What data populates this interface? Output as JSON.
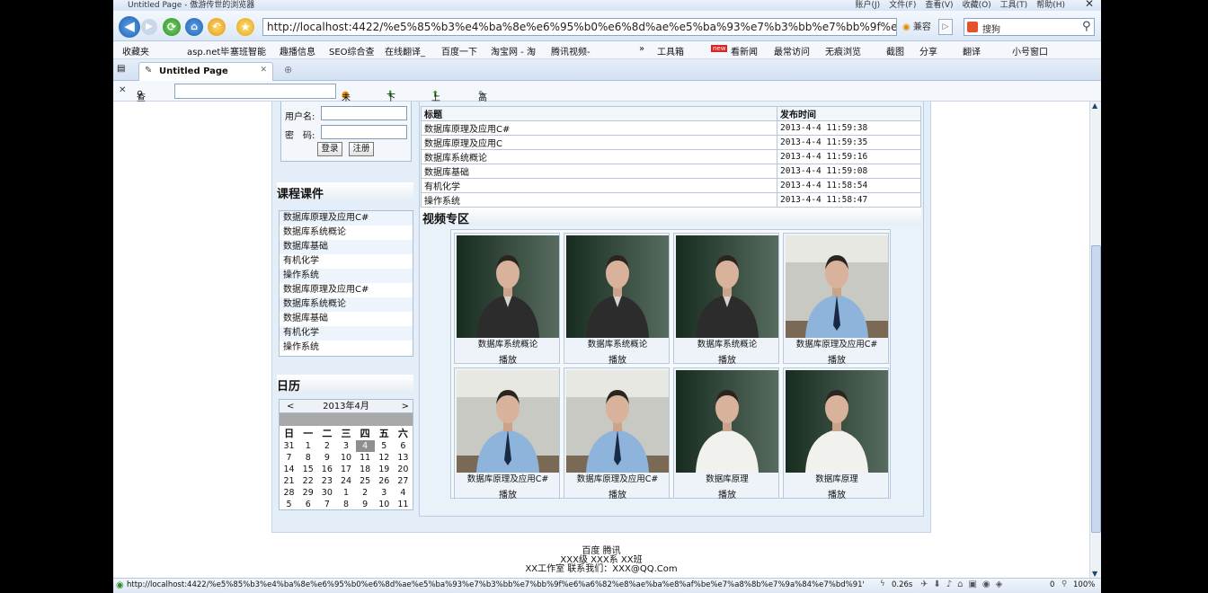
{
  "window": {
    "title": "Untitled Page - 傲游传世的浏览器",
    "menu": [
      "账户(J)",
      "文件(F)",
      "查看(V)",
      "收藏(O)",
      "工具(T)",
      "帮助(H)"
    ]
  },
  "nav": {
    "url": "http://localhost:4422/%e5%85%b3%e4%ba%8e%e6%95%b0%e6%8d%ae%e5%ba%93%e7%b3%bb%e7%bb%9f%e6%a6%",
    "compat": "兼容",
    "search_placeholder": "搜狗"
  },
  "favorites": {
    "left": [
      "收藏夹",
      "asp.net毕",
      "塞班智能",
      "趣播信息",
      "SEO综合查",
      "在线翻译_",
      "百度一下",
      "淘宝网 - 淘",
      "腾讯视频-"
    ],
    "right": [
      "工具箱",
      "看新闻",
      "最常访问",
      "无痕浏览",
      "截图",
      "分享",
      "翻译",
      "小号窗口"
    ]
  },
  "tab": {
    "title": "Untitled Page"
  },
  "find": {
    "label": "查找:",
    "value": "",
    "not_found": "未查找",
    "next": "下一个",
    "prev": "上一个",
    "highlight": "高亮"
  },
  "login": {
    "username_label": "用户名:",
    "password_label": "密　码:",
    "login_btn": "登录",
    "register_btn": "注册"
  },
  "courses": {
    "heading": "课程课件",
    "items": [
      "数据库原理及应用C#",
      "数据库系统概论",
      "数据库基础",
      "有机化学",
      "操作系统",
      "数据库原理及应用C#",
      "数据库系统概论",
      "数据库基础",
      "有机化学",
      "操作系统"
    ]
  },
  "calendar": {
    "heading": "日历",
    "month": "2013年4月",
    "prev": "<",
    "next": ">",
    "weekdays": [
      "日",
      "一",
      "二",
      "三",
      "四",
      "五",
      "六"
    ],
    "weeks": [
      [
        "31",
        "1",
        "2",
        "3",
        "4",
        "5",
        "6"
      ],
      [
        "7",
        "8",
        "9",
        "10",
        "11",
        "12",
        "13"
      ],
      [
        "14",
        "15",
        "16",
        "17",
        "18",
        "19",
        "20"
      ],
      [
        "21",
        "22",
        "23",
        "24",
        "25",
        "26",
        "27"
      ],
      [
        "28",
        "29",
        "30",
        "1",
        "2",
        "3",
        "4"
      ],
      [
        "5",
        "6",
        "7",
        "8",
        "9",
        "10",
        "11"
      ]
    ],
    "selected": "4"
  },
  "news": {
    "col_title": "标题",
    "col_time": "发布时间",
    "rows": [
      {
        "title": "数据库原理及应用C#",
        "time": "2013-4-4 11:59:38"
      },
      {
        "title": "数据库原理及应用C",
        "time": "2013-4-4 11:59:35"
      },
      {
        "title": "数据库系统概论",
        "time": "2013-4-4 11:59:16"
      },
      {
        "title": "数据库基础",
        "time": "2013-4-4 11:59:08"
      },
      {
        "title": "有机化学",
        "time": "2013-4-4 11:58:54"
      },
      {
        "title": "操作系统",
        "time": "2013-4-4 11:58:47"
      }
    ]
  },
  "videos": {
    "heading": "视频专区",
    "play_label": "播放",
    "items": [
      {
        "title": "数据库系统概论",
        "shirt": "dark",
        "board": "green"
      },
      {
        "title": "数据库系统概论",
        "shirt": "dark",
        "board": "green"
      },
      {
        "title": "数据库系统概论",
        "shirt": "dark",
        "board": "green"
      },
      {
        "title": "数据库原理及应用C#",
        "shirt": "blue",
        "board": "room"
      },
      {
        "title": "数据库原理及应用C#",
        "shirt": "blue",
        "board": "room"
      },
      {
        "title": "数据库原理及应用C#",
        "shirt": "blue",
        "board": "room"
      },
      {
        "title": "数据库原理",
        "shirt": "white",
        "board": "green"
      },
      {
        "title": "数据库原理",
        "shirt": "white",
        "board": "green"
      }
    ]
  },
  "footer": {
    "line1": "百度 腾讯",
    "line2": "XXX级 XXX系 XX班",
    "line3": "XX工作室 联系我们：XXX@QQ.Com"
  },
  "status": {
    "url": "http://localhost:4422/%e5%85%b3%e4%ba%8e%e6%95%b0%e6%8d%ae%e5%ba%93%e7%b3%bb%e7%bb%9f%e6%a6%82%e8%ae%ba%e8%af%be%e7%a8%8b%e7%9a%84%e7%bd%91%e7%ab%99...",
    "time": "0.26s",
    "count": "0",
    "zoom": "100%"
  }
}
